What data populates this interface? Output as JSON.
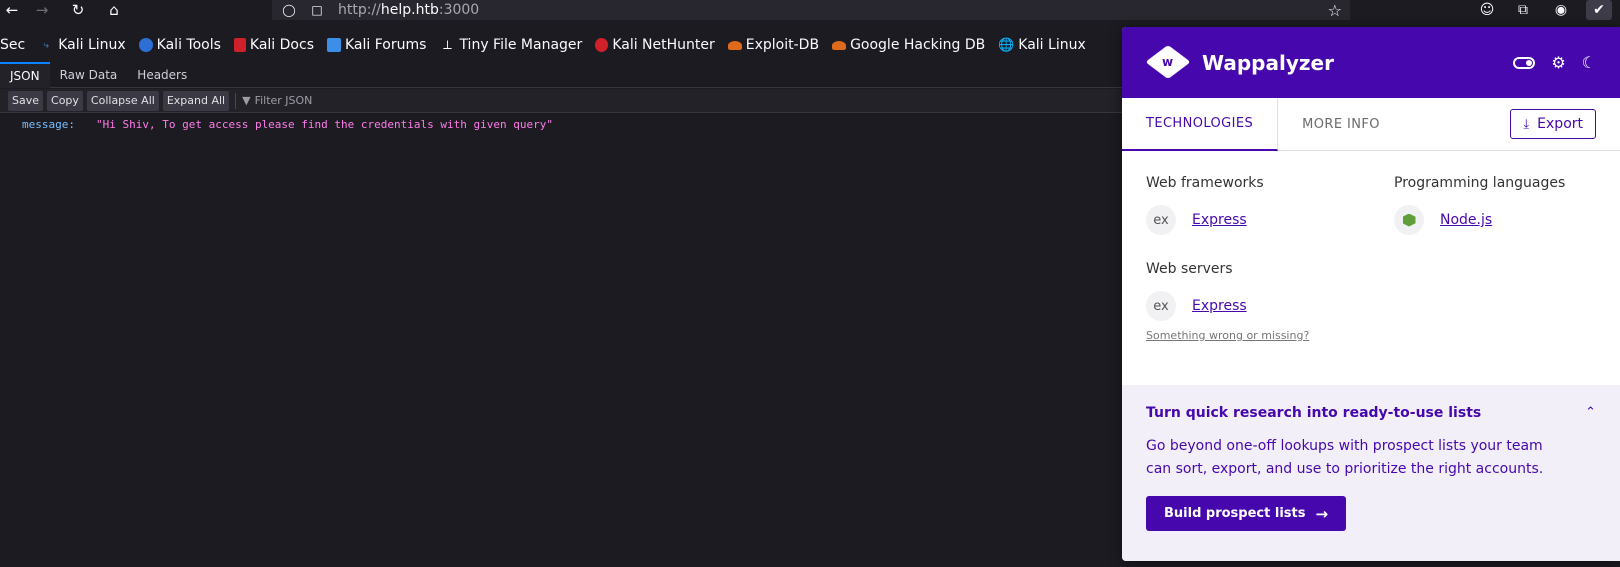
{
  "browser": {
    "url_prefix": "http://",
    "url_host": "help.htb",
    "url_port": ":3000",
    "icons": {
      "back": "arrow-left-icon",
      "forward": "arrow-right-icon",
      "reload": "reload-icon",
      "home": "home-icon",
      "shield": "shield-icon",
      "page": "page-icon",
      "bookmark_star": "star-icon"
    }
  },
  "bookmarks": [
    {
      "label": "Sec"
    },
    {
      "label": "Kali Linux",
      "icon_color": "#2d6fd4"
    },
    {
      "label": "Kali Tools",
      "icon_color": "#e03b2b"
    },
    {
      "label": "Kali Docs",
      "icon_color": "#d0202a"
    },
    {
      "label": "Kali Forums",
      "icon_color": "#3c8ee6"
    },
    {
      "label": "Tiny File Manager"
    },
    {
      "label": "Kali NetHunter",
      "icon_color": "#d0202a"
    },
    {
      "label": "Exploit-DB",
      "icon_color": "#e06a1c"
    },
    {
      "label": "Google Hacking DB",
      "icon_color": "#e06a1c"
    },
    {
      "label": "Kali Linux"
    }
  ],
  "json_viewer": {
    "tabs": [
      "JSON",
      "Raw Data",
      "Headers"
    ],
    "toolbar": {
      "save": "Save",
      "copy": "Copy",
      "collapse": "Collapse All",
      "expand": "Expand All",
      "filter_placeholder": "Filter JSON"
    },
    "rows": [
      {
        "key": "message:",
        "value": "\"Hi Shiv, To get access please find the credentials with given query\""
      }
    ]
  },
  "wappalyzer": {
    "title": "Wappalyzer",
    "tabs": {
      "technologies": "TECHNOLOGIES",
      "more_info": "MORE INFO"
    },
    "export_label": "Export",
    "categories": {
      "web_frameworks": {
        "title": "Web frameworks",
        "tech": {
          "name": "Express",
          "icon_text": "ex"
        }
      },
      "programming_languages": {
        "title": "Programming languages",
        "tech": {
          "name": "Node.js",
          "icon_color": "#5f9e3a"
        }
      },
      "web_servers": {
        "title": "Web servers",
        "tech": {
          "name": "Express",
          "icon_text": "ex"
        }
      }
    },
    "wrong_link": "Something wrong or missing?",
    "promo": {
      "title": "Turn quick research into ready-to-use lists",
      "text": "Go beyond one-off lookups with prospect lists your team can sort, export, and use to prioritize the right accounts.",
      "button": "Build prospect lists"
    },
    "colors": {
      "brand": "#4608ad",
      "promo_bg": "#f2eff8"
    }
  }
}
